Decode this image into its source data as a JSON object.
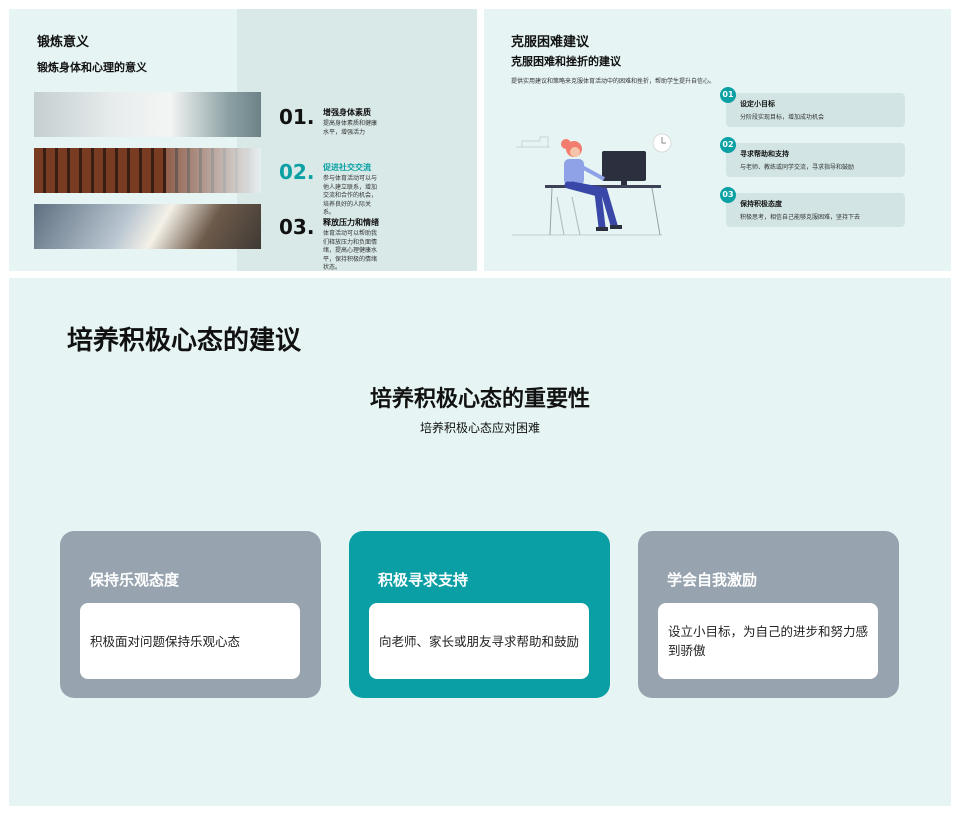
{
  "slide1": {
    "title": "锻炼意义",
    "subtitle": "锻炼身体和心理的意义",
    "items": [
      {
        "num": "01.",
        "title": "增强身体素质",
        "desc": "提高身体素质和健康水平，增强活力"
      },
      {
        "num": "02.",
        "title": "促进社交交流",
        "desc": "参与体育活动可以与他人建立联系，增加交流和合作的机会，培养良好的人际关系。"
      },
      {
        "num": "03.",
        "title": "释放压力和情绪",
        "desc": "体育活动可以帮助我们释放压力和负面情绪，提高心理健康水平，保持积极的情绪状态。"
      }
    ]
  },
  "slide2": {
    "title": "克服困难建议",
    "subtitle": "克服困难和挫折的建议",
    "intro": "提供实用建议和策略来克服体育活动中的困难和挫折，帮助学生提升自信心。",
    "cards": [
      {
        "num": "01",
        "title": "设定小目标",
        "desc": "分阶段实现目标，增加成功机会"
      },
      {
        "num": "02",
        "title": "寻求帮助和支持",
        "desc": "与老师、教练或同学交流，寻求指导和鼓励"
      },
      {
        "num": "03",
        "title": "保持积极态度",
        "desc": "积极思考，相信自己能够克服困难，坚持下去"
      }
    ]
  },
  "slide3": {
    "title": "培养积极心态的建议",
    "heading": "培养积极心态的重要性",
    "subheading": "培养积极心态应对困难",
    "cards": [
      {
        "title": "保持乐观态度",
        "text": "积极面对问题保持乐观心态"
      },
      {
        "title": "积极寻求支持",
        "text": "向老师、家长或朋友寻求帮助和鼓励"
      },
      {
        "title": "学会自我激励",
        "text": "设立小目标，为自己的进步和努力感到骄傲"
      }
    ]
  },
  "colors": {
    "accent": "#0aa0a4",
    "background": "#e6f5f4",
    "card_gray": "#97a4b0"
  }
}
